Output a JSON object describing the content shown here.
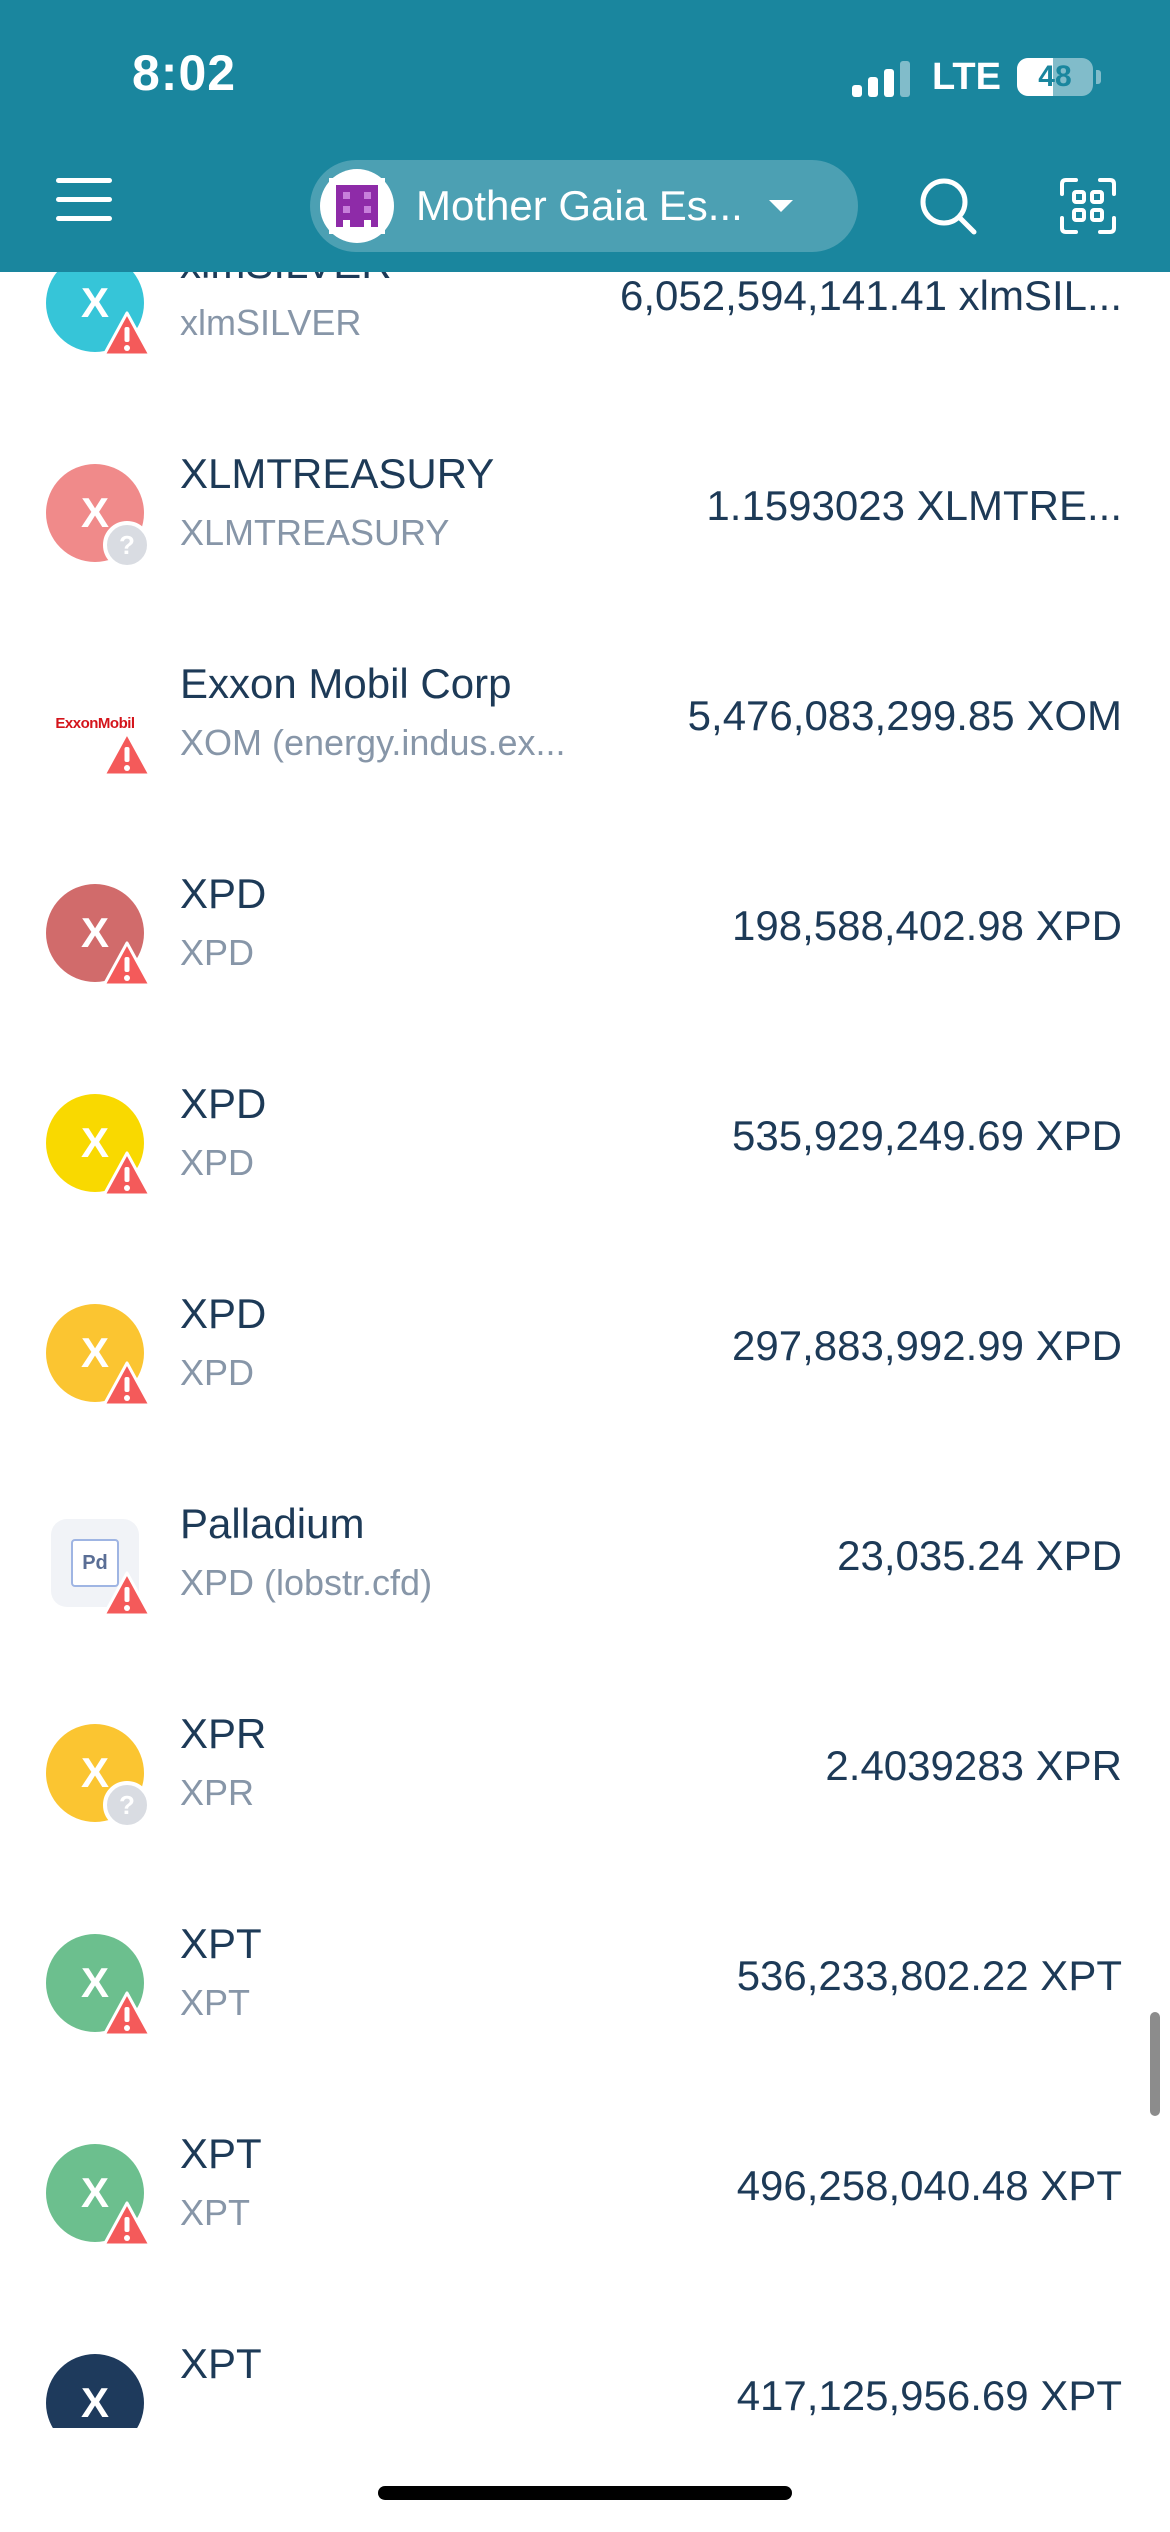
{
  "status_bar": {
    "time": "8:02",
    "network": "LTE",
    "battery": "48",
    "battery_level": 0.48
  },
  "header": {
    "account_name": "Mother Gaia Es...",
    "icons": [
      "menu-icon",
      "search-icon",
      "scan-icon"
    ]
  },
  "assets": [
    {
      "initial": "X",
      "name": "xlmSILVER",
      "code": "xlmSILVER",
      "amount": "6,052,594,141.41 xlmSIL...",
      "color": "#36c5d8",
      "badge": "warning"
    },
    {
      "initial": "X",
      "name": "XLMTREASURY",
      "code": "XLMTREASURY",
      "amount": "1.1593023 XLMTRE...",
      "color": "#f08a8a",
      "badge": "unknown"
    },
    {
      "initial": "",
      "logo": "ExxonMobil",
      "name": "Exxon Mobil Corp",
      "code": "XOM (energy.indus.ex...",
      "amount": "5,476,083,299.85 XOM",
      "color": "#ffffff",
      "badge": "warning"
    },
    {
      "initial": "X",
      "name": "XPD",
      "code": "XPD",
      "amount": "198,588,402.98 XPD",
      "color": "#d16b6b",
      "badge": "warning"
    },
    {
      "initial": "X",
      "name": "XPD",
      "code": "XPD",
      "amount": "535,929,249.69 XPD",
      "color": "#f9d900",
      "badge": "warning"
    },
    {
      "initial": "X",
      "name": "XPD",
      "code": "XPD",
      "amount": "297,883,992.99 XPD",
      "color": "#fbc531",
      "badge": "warning"
    },
    {
      "initial": "",
      "logo": "Pd",
      "name": "Palladium",
      "code": "XPD (lobstr.cfd)",
      "amount": "23,035.24 XPD",
      "color": "#f1f3f7",
      "badge": "warning"
    },
    {
      "initial": "X",
      "name": "XPR",
      "code": "XPR",
      "amount": "2.4039283 XPR",
      "color": "#fbc531",
      "badge": "unknown"
    },
    {
      "initial": "X",
      "name": "XPT",
      "code": "XPT",
      "amount": "536,233,802.22 XPT",
      "color": "#6cbf8e",
      "badge": "warning"
    },
    {
      "initial": "X",
      "name": "XPT",
      "code": "XPT",
      "amount": "496,258,040.48 XPT",
      "color": "#6cbf8e",
      "badge": "warning"
    },
    {
      "initial": "X",
      "name": "XPT",
      "code": "",
      "amount": "417,125,956.69 XPT",
      "color": "#1e3a5c",
      "badge": "none"
    }
  ]
}
